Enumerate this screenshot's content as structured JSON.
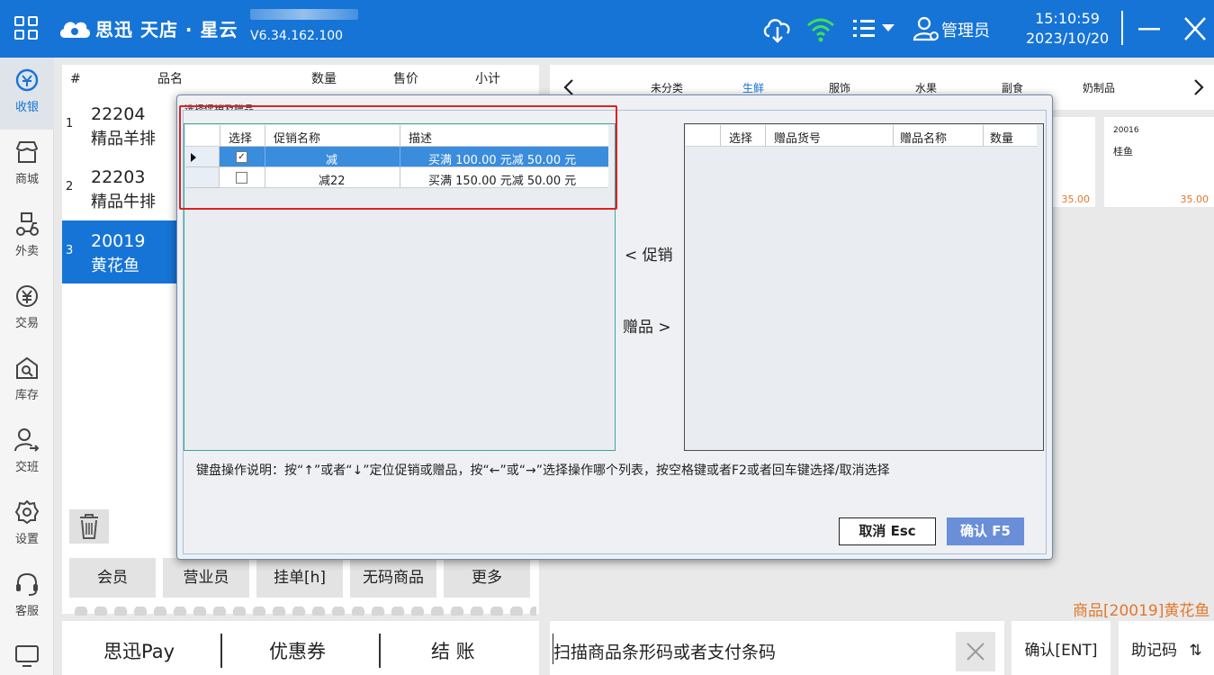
{
  "app": {
    "brand": "思迅 天店 · 星云",
    "version": "V6.34.162.100",
    "user": "管理员",
    "time": "15:10:59",
    "date": "2023/10/20",
    "accent_color": "#1674d6"
  },
  "sidebar": {
    "items": [
      {
        "label": "收银",
        "icon": "cashier-icon"
      },
      {
        "label": "商城",
        "icon": "store-icon"
      },
      {
        "label": "外卖",
        "icon": "delivery-icon"
      },
      {
        "label": "交易",
        "icon": "yen-icon"
      },
      {
        "label": "库存",
        "icon": "inventory-icon"
      },
      {
        "label": "交班",
        "icon": "handover-icon"
      },
      {
        "label": "设置",
        "icon": "gear-icon"
      },
      {
        "label": "客服",
        "icon": "headset-icon"
      },
      {
        "label": "后台",
        "icon": "monitor-icon"
      }
    ]
  },
  "order": {
    "headers": {
      "idx": "#",
      "name": "品名",
      "qty": "数量",
      "price": "售价",
      "subtotal": "小计"
    },
    "rows": [
      {
        "idx": "1",
        "code": "22204",
        "name": "精品羊排"
      },
      {
        "idx": "2",
        "code": "22203",
        "name": "精品牛排"
      },
      {
        "idx": "3",
        "code": "20019",
        "name": "黄花鱼"
      }
    ]
  },
  "functions": [
    "会员",
    "营业员",
    "挂单[h]",
    "无码商品",
    "更多"
  ],
  "paybar": {
    "pay": "思迅Pay",
    "coupon": "优惠券",
    "checkout": "结 账"
  },
  "scan": {
    "placeholder": "扫描商品条形码或者支付条码"
  },
  "confirm_label": "确认[ENT]",
  "help_label": "助记码",
  "help_glyph": "⇅",
  "current_goods": "商品[20019]黄花鱼",
  "categories": [
    "未分类",
    "生鲜",
    "服饰",
    "水果",
    "副食",
    "奶制品"
  ],
  "cards": [
    {
      "code": "",
      "name": "",
      "price": "35.00"
    },
    {
      "code": "20016",
      "name": "桂鱼",
      "price": "35.00"
    }
  ],
  "dialog": {
    "title": "选择促销及赠品",
    "promo_headers": {
      "select": "选择",
      "name": "促销名称",
      "desc": "描述"
    },
    "promos": [
      {
        "checked": true,
        "name": "减",
        "desc": "买满 100.00 元减 50.00 元"
      },
      {
        "checked": false,
        "name": "减22",
        "desc": "买满 150.00 元减 50.00 元"
      }
    ],
    "gift_headers": {
      "select": "选择",
      "code": "赠品货号",
      "name": "赠品名称",
      "qty": "数量"
    },
    "promo_btn": "< 促销",
    "gift_btn": "赠品 >",
    "hint": "键盘操作说明：按“↑”或者“↓”定位促销或赠品，按“←”或“→”选择操作哪个列表，按空格键或者F2或者回车键选择/取消选择",
    "cancel": "取消 Esc",
    "ok": "确认 F5"
  }
}
